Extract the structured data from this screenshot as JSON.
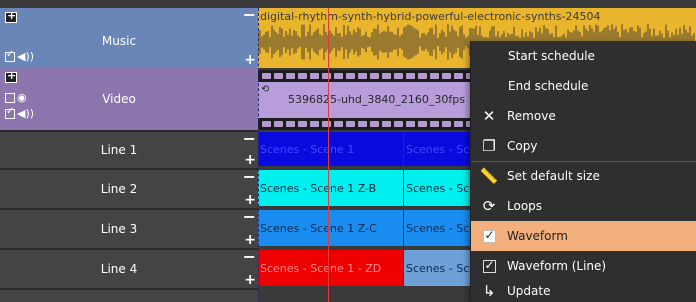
{
  "tracks": {
    "music": {
      "name": "Music",
      "minus": "−",
      "plus": "+"
    },
    "video": {
      "name": "Video"
    },
    "lines": [
      {
        "name": "Line 1",
        "minus": "−",
        "plus": "+"
      },
      {
        "name": "Line 2",
        "minus": "−",
        "plus": "+"
      },
      {
        "name": "Line 3",
        "minus": "−",
        "plus": "+"
      },
      {
        "name": "Line 4",
        "minus": "−",
        "plus": "+"
      }
    ]
  },
  "clips": {
    "music_label": "digital-rhythm-synth-hybrid-powerful-electronic-synths-24504",
    "video_label": "5396825-uhd_3840_2160_30fps",
    "line1": [
      "Scenes - Scene 1",
      "Scenes - Scene 1"
    ],
    "line2": [
      "Scenes - Scene 1 Z-B",
      "Scenes - Scene 1"
    ],
    "line3": [
      "Scenes - Scene 1 Z-C",
      "Scenes - Scene 1"
    ],
    "line4": [
      "Scenes - Scene 1 - ZD",
      "Scenes - Scene 1"
    ]
  },
  "colors": {
    "line1": "#0a0adf",
    "line2": "#00f0f0",
    "line3": "#1a8df0",
    "line4": "#ee0000",
    "line4b": "#6fa0d8",
    "menu_highlight": "#f3b07c",
    "playhead": "#e23a3a"
  },
  "menu": {
    "start_schedule": "Start schedule",
    "end_schedule": "End schedule",
    "remove": "Remove",
    "copy": "Copy",
    "set_default_size": "Set default size",
    "loops": "Loops",
    "waveform": "Waveform",
    "waveform_line": "Waveform (Line)",
    "update": "Update"
  },
  "icons": {
    "remove": "close-icon",
    "copy": "copy-icon",
    "set_default_size": "ruler-icon",
    "loops": "loop-icon",
    "update": "update-arrow-icon"
  }
}
